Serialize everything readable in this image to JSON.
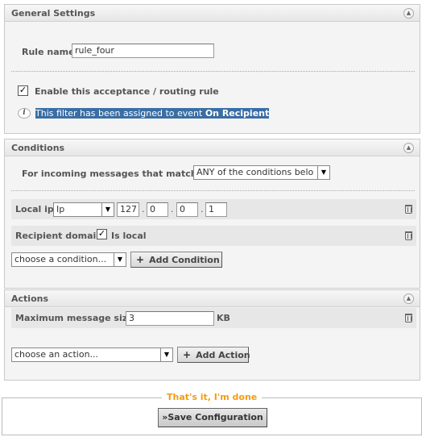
{
  "general": {
    "title": "General Settings",
    "rule_name_label": "Rule name",
    "rule_name_value": "rule_four",
    "enable_label": "Enable this acceptance / routing rule",
    "enable_checked": true,
    "info_prefix": "This filter has been assigned to event ",
    "info_event": "On Recipient"
  },
  "conditions": {
    "title": "Conditions",
    "match_label": "For incoming messages that match",
    "match_value": "ANY of the conditions below",
    "rows": {
      "local_ip": {
        "label": "Local ip",
        "type_value": "Ip",
        "octets": [
          "127",
          "0",
          "0",
          "1"
        ],
        "separator": "."
      },
      "recipient_domain": {
        "label": "Recipient domain",
        "checked": true,
        "suffix": "Is local"
      }
    },
    "choose_placeholder": "choose a condition...",
    "add_label": "Add Condition"
  },
  "actions": {
    "title": "Actions",
    "max_size_label": "Maximum message size",
    "max_size_value": "3",
    "max_size_unit": "KB",
    "choose_placeholder": "choose an action...",
    "add_label": "Add Action"
  },
  "footer": {
    "legend": "That's it, I'm done",
    "save_label": "Save Configuration",
    "save_prefix": "»"
  },
  "icons": {
    "collapse": "chevron-up-icon",
    "dropdown": "triangle-down-icon",
    "info": "info-icon",
    "delete": "trash-icon",
    "add": "plus-icon",
    "checkbox": "check-icon"
  }
}
